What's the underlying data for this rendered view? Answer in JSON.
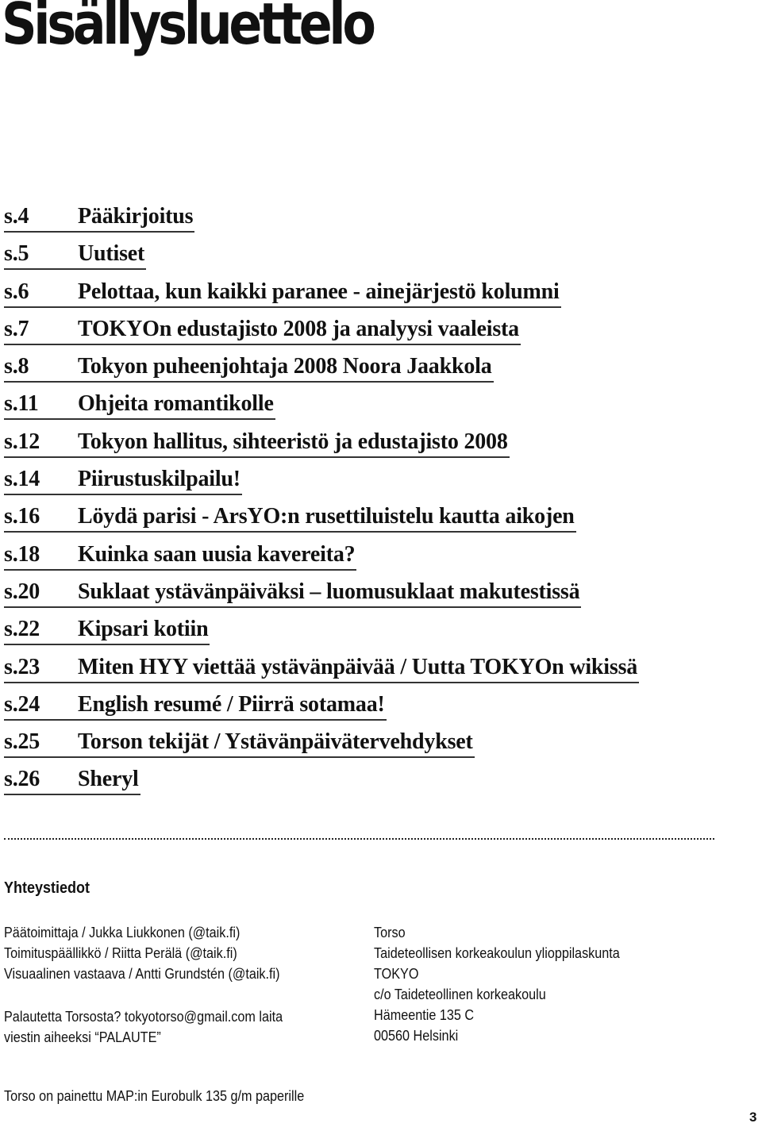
{
  "title": "Sisällysluettelo",
  "toc": [
    {
      "page": "s.4",
      "title": "Pääkirjoitus"
    },
    {
      "page": "s.5",
      "title": "Uutiset "
    },
    {
      "page": "s.6",
      "title": "Pelottaa, kun kaikki paranee - ainejärjestö kolumni"
    },
    {
      "page": "s.7",
      "title": "TOKYOn edustajisto 2008 ja analyysi vaaleista"
    },
    {
      "page": "s.8",
      "title": "Tokyon puheenjohtaja 2008 Noora Jaakkola"
    },
    {
      "page": "s.11",
      "title": "Ohjeita romantikolle "
    },
    {
      "page": "s.12",
      "title": "Tokyon hallitus, sihteeristö ja edustajisto 2008"
    },
    {
      "page": "s.14",
      "title": "Piirustuskilpailu!"
    },
    {
      "page": "s.16",
      "title": "Löydä parisi - ArsYO:n rusettiluistelu kautta aikojen"
    },
    {
      "page": "s.18",
      "title": "Kuinka saan uusia kavereita? "
    },
    {
      "page": "s.20",
      "title": "Suklaat ystävänpäiväksi – luomusuklaat makutestissä"
    },
    {
      "page": "s.22",
      "title": "Kipsari kotiin"
    },
    {
      "page": "s.23",
      "title": "Miten HYY viettää ystävänpäivää / Uutta TOKYOn wikissä"
    },
    {
      "page": "s.24",
      "title": "English resumé / Piirrä sotamaa! "
    },
    {
      "page": "s.25",
      "title": "Torson tekijät / Ystävänpäivätervehdykset"
    },
    {
      "page": "s.26",
      "title": "Sheryl"
    }
  ],
  "contact": {
    "heading": "Yhteystiedot",
    "staff": [
      "Päätoimittaja / Jukka Liukkonen (@taik.fi)",
      "Toimituspäällikkö / Riitta Perälä (@taik.fi)",
      "Visuaalinen vastaava / Antti Grundstén (@taik.fi)"
    ],
    "feedback": {
      "prefix": "Palautetta Torsosta? ",
      "email": "tokyotorso@gmail.com",
      "suffix": " laita",
      "line2": "viestin aiheeksi “PALAUTE”"
    },
    "address": [
      "Torso",
      "Taideteollisen korkeakoulun ylioppilaskunta",
      "TOKYO",
      "c/o Taideteollinen korkeakoulu",
      "Hämeentie 135 C",
      "00560 Helsinki"
    ]
  },
  "printing_note": "Torso on painettu MAP:in Eurobulk 135 g/m paperille",
  "page_number": "3"
}
